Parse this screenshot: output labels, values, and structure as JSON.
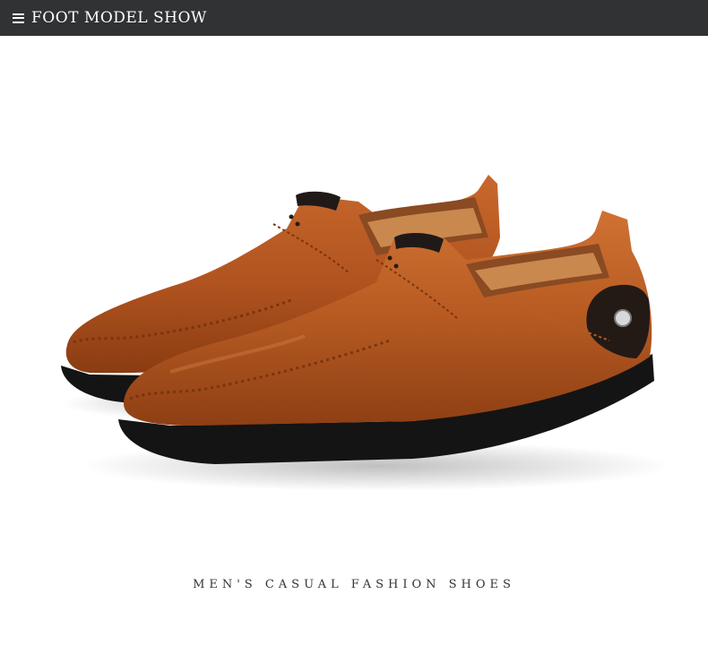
{
  "header": {
    "title": "FOOT MODEL SHOW",
    "icon": "menu-icon",
    "background": "#303234"
  },
  "product_image": {
    "subject": "pair of brown leather slip-on loafers with black rubber soles",
    "leather_color": "#b0531f",
    "sole_color": "#141414"
  },
  "caption": "MEN'S CASUAL FASHION SHOES"
}
